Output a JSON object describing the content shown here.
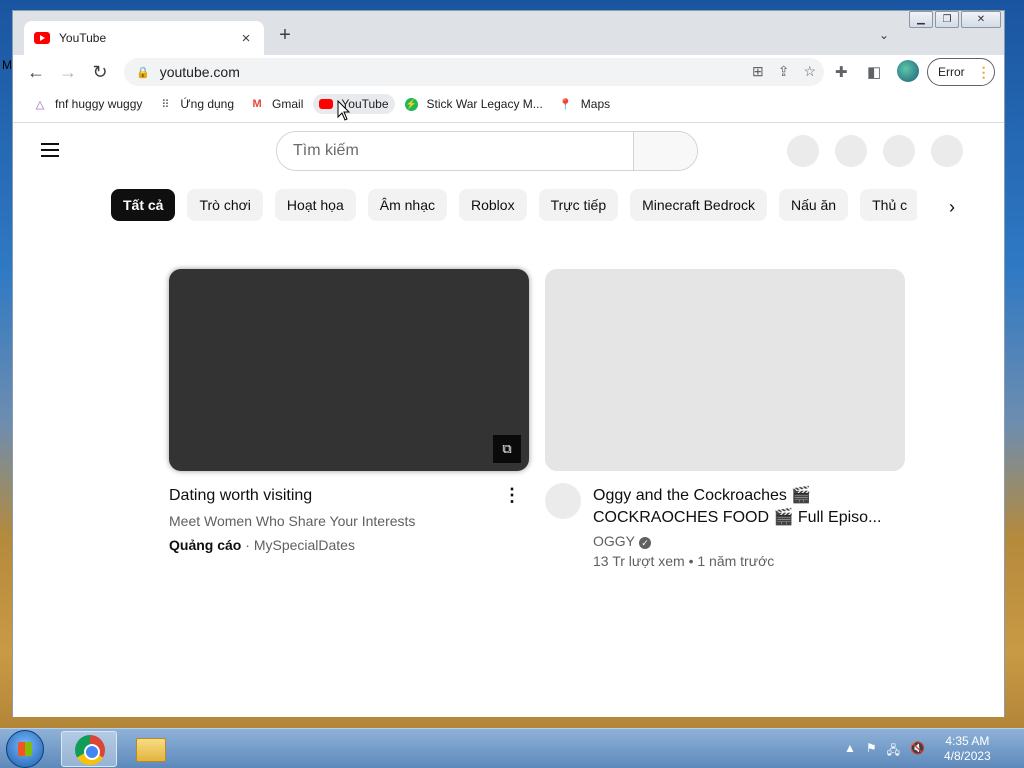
{
  "desktop": {
    "edge_letter": "M"
  },
  "browser": {
    "tab": {
      "title": "YouTube",
      "close": "×"
    },
    "new_tab": "+",
    "tab_search": "⌄",
    "window_controls": {
      "minimize": "▁",
      "maximize": "❐",
      "close": "✕"
    },
    "toolbar": {
      "back": "←",
      "forward": "→",
      "reload": "↻",
      "url": "youtube.com",
      "error_label": "Error",
      "error_dots": "⋮"
    },
    "bookmarks": [
      {
        "label": "fnf huggy wuggy",
        "icon": "triangle-icon"
      },
      {
        "label": "Ứng dụng",
        "icon": "apps-grid-icon"
      },
      {
        "label": "Gmail",
        "icon": "gmail-icon"
      },
      {
        "label": "YouTube",
        "icon": "youtube-icon"
      },
      {
        "label": "Stick War Legacy M...",
        "icon": "bolt-icon"
      },
      {
        "label": "Maps",
        "icon": "maps-pin-icon"
      }
    ]
  },
  "youtube": {
    "search_placeholder": "Tìm kiếm",
    "chips": [
      "Tất cả",
      "Trò chơi",
      "Hoạt họa",
      "Âm nhạc",
      "Roblox",
      "Trực tiếp",
      "Minecraft Bedrock",
      "Nấu ăn",
      "Thủ c"
    ],
    "ad_card": {
      "title": "Dating worth visiting",
      "subtitle": "Meet Women Who Share Your Interests",
      "ad_label": "Quảng cáo",
      "advertiser": "MySpecialDates"
    },
    "video_card": {
      "title_line1": "Oggy and the Cockroaches 🎬",
      "title_line2": "COCKRAOCHES FOOD 🎬 Full Episo...",
      "channel": "OGGY",
      "meta": "13 Tr lượt xem • 1 năm trước"
    }
  },
  "taskbar": {
    "time": "4:35 AM",
    "date": "4/8/2023"
  }
}
